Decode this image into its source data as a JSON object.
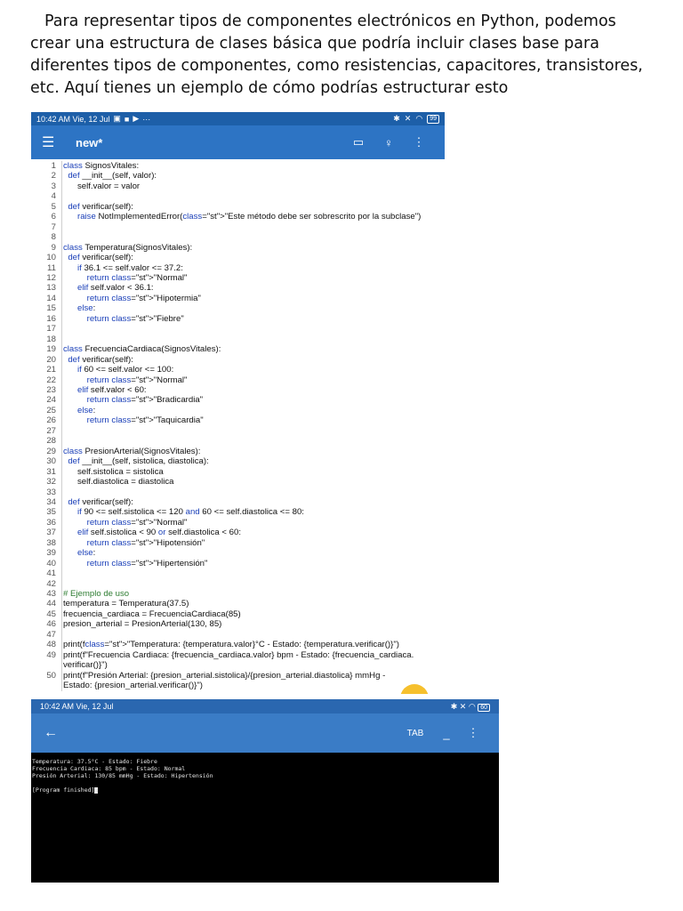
{
  "intro_text": "Para representar tipos de componentes electrónicos en Python, podemos crear una estructura de clases básica que podría incluir clases base para diferentes tipos de componentes, como resistencias, capacitores, transistores, etc. Aquí tienes un ejemplo de cómo podrías estructurar esto",
  "editor": {
    "status_bar": {
      "time": "10:42 AM Vie, 12 Jul",
      "battery": "99"
    },
    "app_bar": {
      "menu_icon": "menu-icon",
      "title": "new*",
      "icons": [
        "folder-icon",
        "lightbulb-icon",
        "more-vert-icon"
      ]
    },
    "lines": [
      {
        "n": "1",
        "t": "class SignosVitales:"
      },
      {
        "n": "2",
        "t": "  def __init__(self, valor):"
      },
      {
        "n": "3",
        "t": "      self.valor = valor"
      },
      {
        "n": "4",
        "t": ""
      },
      {
        "n": "5",
        "t": "  def verificar(self):"
      },
      {
        "n": "6",
        "t": "      raise NotImplementedError(\"Este método debe ser sobrescrito por la subclase\")"
      },
      {
        "n": "7",
        "t": ""
      },
      {
        "n": "8",
        "t": ""
      },
      {
        "n": "9",
        "t": "class Temperatura(SignosVitales):"
      },
      {
        "n": "10",
        "t": "  def verificar(self):"
      },
      {
        "n": "11",
        "t": "      if 36.1 <= self.valor <= 37.2:"
      },
      {
        "n": "12",
        "t": "          return \"Normal\""
      },
      {
        "n": "13",
        "t": "      elif self.valor < 36.1:"
      },
      {
        "n": "14",
        "t": "          return \"Hipotermia\""
      },
      {
        "n": "15",
        "t": "      else:"
      },
      {
        "n": "16",
        "t": "          return \"Fiebre\""
      },
      {
        "n": "17",
        "t": ""
      },
      {
        "n": "18",
        "t": ""
      },
      {
        "n": "19",
        "t": "class FrecuenciaCardiaca(SignosVitales):"
      },
      {
        "n": "20",
        "t": "  def verificar(self):"
      },
      {
        "n": "21",
        "t": "      if 60 <= self.valor <= 100:"
      },
      {
        "n": "22",
        "t": "          return \"Normal\""
      },
      {
        "n": "23",
        "t": "      elif self.valor < 60:"
      },
      {
        "n": "24",
        "t": "          return \"Bradicardia\""
      },
      {
        "n": "25",
        "t": "      else:"
      },
      {
        "n": "26",
        "t": "          return \"Taquicardia\""
      },
      {
        "n": "27",
        "t": ""
      },
      {
        "n": "28",
        "t": ""
      },
      {
        "n": "29",
        "t": "class PresionArterial(SignosVitales):"
      },
      {
        "n": "30",
        "t": "  def __init__(self, sistolica, diastolica):"
      },
      {
        "n": "31",
        "t": "      self.sistolica = sistolica"
      },
      {
        "n": "32",
        "t": "      self.diastolica = diastolica"
      },
      {
        "n": "33",
        "t": ""
      },
      {
        "n": "34",
        "t": "  def verificar(self):"
      },
      {
        "n": "35",
        "t": "      if 90 <= self.sistolica <= 120 and 60 <= self.diastolica <= 80:"
      },
      {
        "n": "36",
        "t": "          return \"Normal\""
      },
      {
        "n": "37",
        "t": "      elif self.sistolica < 90 or self.diastolica < 60:"
      },
      {
        "n": "38",
        "t": "          return \"Hipotensión\""
      },
      {
        "n": "39",
        "t": "      else:"
      },
      {
        "n": "40",
        "t": "          return \"Hipertensión\""
      },
      {
        "n": "41",
        "t": ""
      },
      {
        "n": "42",
        "t": ""
      },
      {
        "n": "43",
        "t": "# Ejemplo de uso"
      },
      {
        "n": "44",
        "t": "temperatura = Temperatura(37.5)"
      },
      {
        "n": "45",
        "t": "frecuencia_cardiaca = FrecuenciaCardiaca(85)"
      },
      {
        "n": "46",
        "t": "presion_arterial = PresionArterial(130, 85)"
      },
      {
        "n": "47",
        "t": ""
      },
      {
        "n": "48",
        "t": "print(f\"Temperatura: {temperatura.valor}°C - Estado: {temperatura.verificar()}\")"
      },
      {
        "n": "49",
        "t": "print(f\"Frecuencia Cardiaca: {frecuencia_cardiaca.valor} bpm - Estado: {frecuencia_cardiaca."
      },
      {
        "n": "",
        "t": "verificar()}\")"
      },
      {
        "n": "50",
        "t": "print(f\"Presión Arterial: {presion_arterial.sistolica}/{presion_arterial.diastolica} mmHg -"
      },
      {
        "n": "",
        "t": "Estado: {presion_arterial.verificar()}\")"
      }
    ]
  },
  "terminal": {
    "status_bar": {
      "time": "10:42 AM Vie, 12 Jul",
      "battery": "60"
    },
    "app_bar": {
      "back_icon": "arrow-back-icon",
      "tab_label": "TAB",
      "minimize_label": "_",
      "more_icon": "more-vert-icon"
    },
    "output": [
      "Temperatura: 37.5°C - Estado: Fiebre",
      "Frecuencia Cardiaca: 85 bpm - Estado: Normal",
      "Presión Arterial: 130/85 mmHg - Estado: Hipertensión",
      "",
      "[Program finished]"
    ]
  }
}
